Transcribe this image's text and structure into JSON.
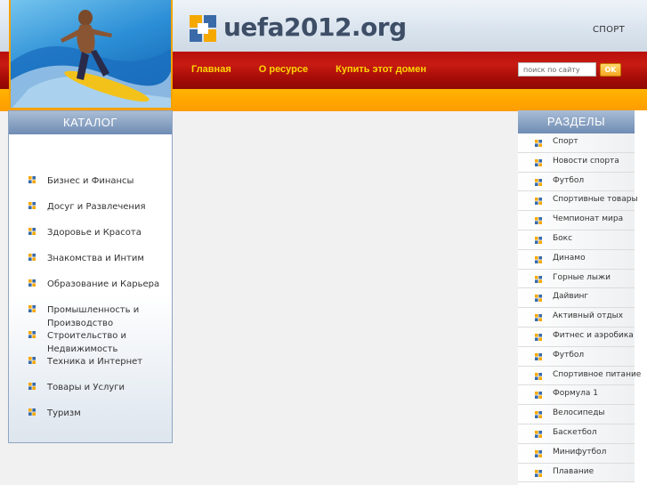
{
  "header": {
    "site_name": "uefa2012.org",
    "category": "СПОРТ",
    "nav": [
      "Главная",
      "О ресурсе",
      "Купить этот домен"
    ],
    "search": {
      "placeholder": "поиск по сайту",
      "button": "OK"
    }
  },
  "catalog": {
    "title": "КАТАЛОГ",
    "items": [
      "Бизнес и Финансы",
      "Досуг и Развлечения",
      "Здоровье и Красота",
      "Знакомства и Интим",
      "Образование и Карьера",
      "Промышленность и Производство",
      "Строительство и Недвижимость",
      "Техника и Интернет",
      "Товары и Услуги",
      "Туризм"
    ]
  },
  "sections": {
    "title": "РАЗДЕЛЫ",
    "items": [
      "Спорт",
      "Новости спорта",
      "Футбол",
      "Спортивные товары",
      "Чемпионат мира",
      "Бокс",
      "Динамо",
      "Горные лыжи",
      "Дайвинг",
      "Активный отдых",
      "Фитнес и аэробика",
      "Футбол",
      "Спортивное питание",
      "Формула 1",
      "Велосипеды",
      "Баскетбол",
      "Минифутбол",
      "Плавание"
    ]
  },
  "icons": {
    "logo": "logo-squares-icon",
    "bullet": "bullet-squares-icon"
  },
  "colors": {
    "red_band": "#b80f0a",
    "orange_band": "#ff9c00",
    "nav_text": "#ffd500",
    "panel_header": "#7d97ba",
    "bullet_orange": "#f5a800",
    "bullet_blue": "#3a6aa8"
  }
}
